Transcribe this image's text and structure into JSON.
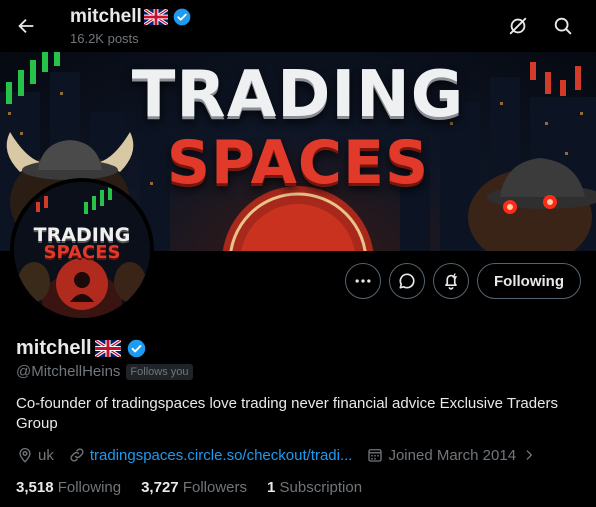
{
  "header": {
    "title": "mitchell",
    "posts_count": "16.2K posts",
    "back_icon": "arrow-left-icon",
    "icons": [
      "no-notifications-icon",
      "search-icon"
    ]
  },
  "banner": {
    "line1": "TRADING",
    "line2": "SPACES"
  },
  "avatar": {
    "line1": "TRADING",
    "line2": "SPACES"
  },
  "actions": {
    "more_icon": "more-icon",
    "message_icon": "message-icon",
    "notify_icon": "notification-bell-icon",
    "following_label": "Following"
  },
  "profile": {
    "name": "mitchell",
    "flag": "uk-flag-icon",
    "verified_color": "#1d9bf0",
    "handle": "@MitchellHeins",
    "follows_you": "Follows you",
    "bio": "Co-founder of tradingspaces love trading  never financial advice Exclusive Traders Group",
    "location": "uk",
    "link": "tradingspaces.circle.so/checkout/tradi...",
    "joined": "Joined March 2014"
  },
  "stats": {
    "following_count": "3,518",
    "following_label": "Following",
    "followers_count": "3,727",
    "followers_label": "Followers",
    "subscription_count": "1",
    "subscription_label": "Subscription"
  },
  "colors": {
    "background": "#000000",
    "text": "#e7e9ea",
    "muted": "#71767b",
    "accent": "#1d9bf0",
    "border": "#536471"
  }
}
